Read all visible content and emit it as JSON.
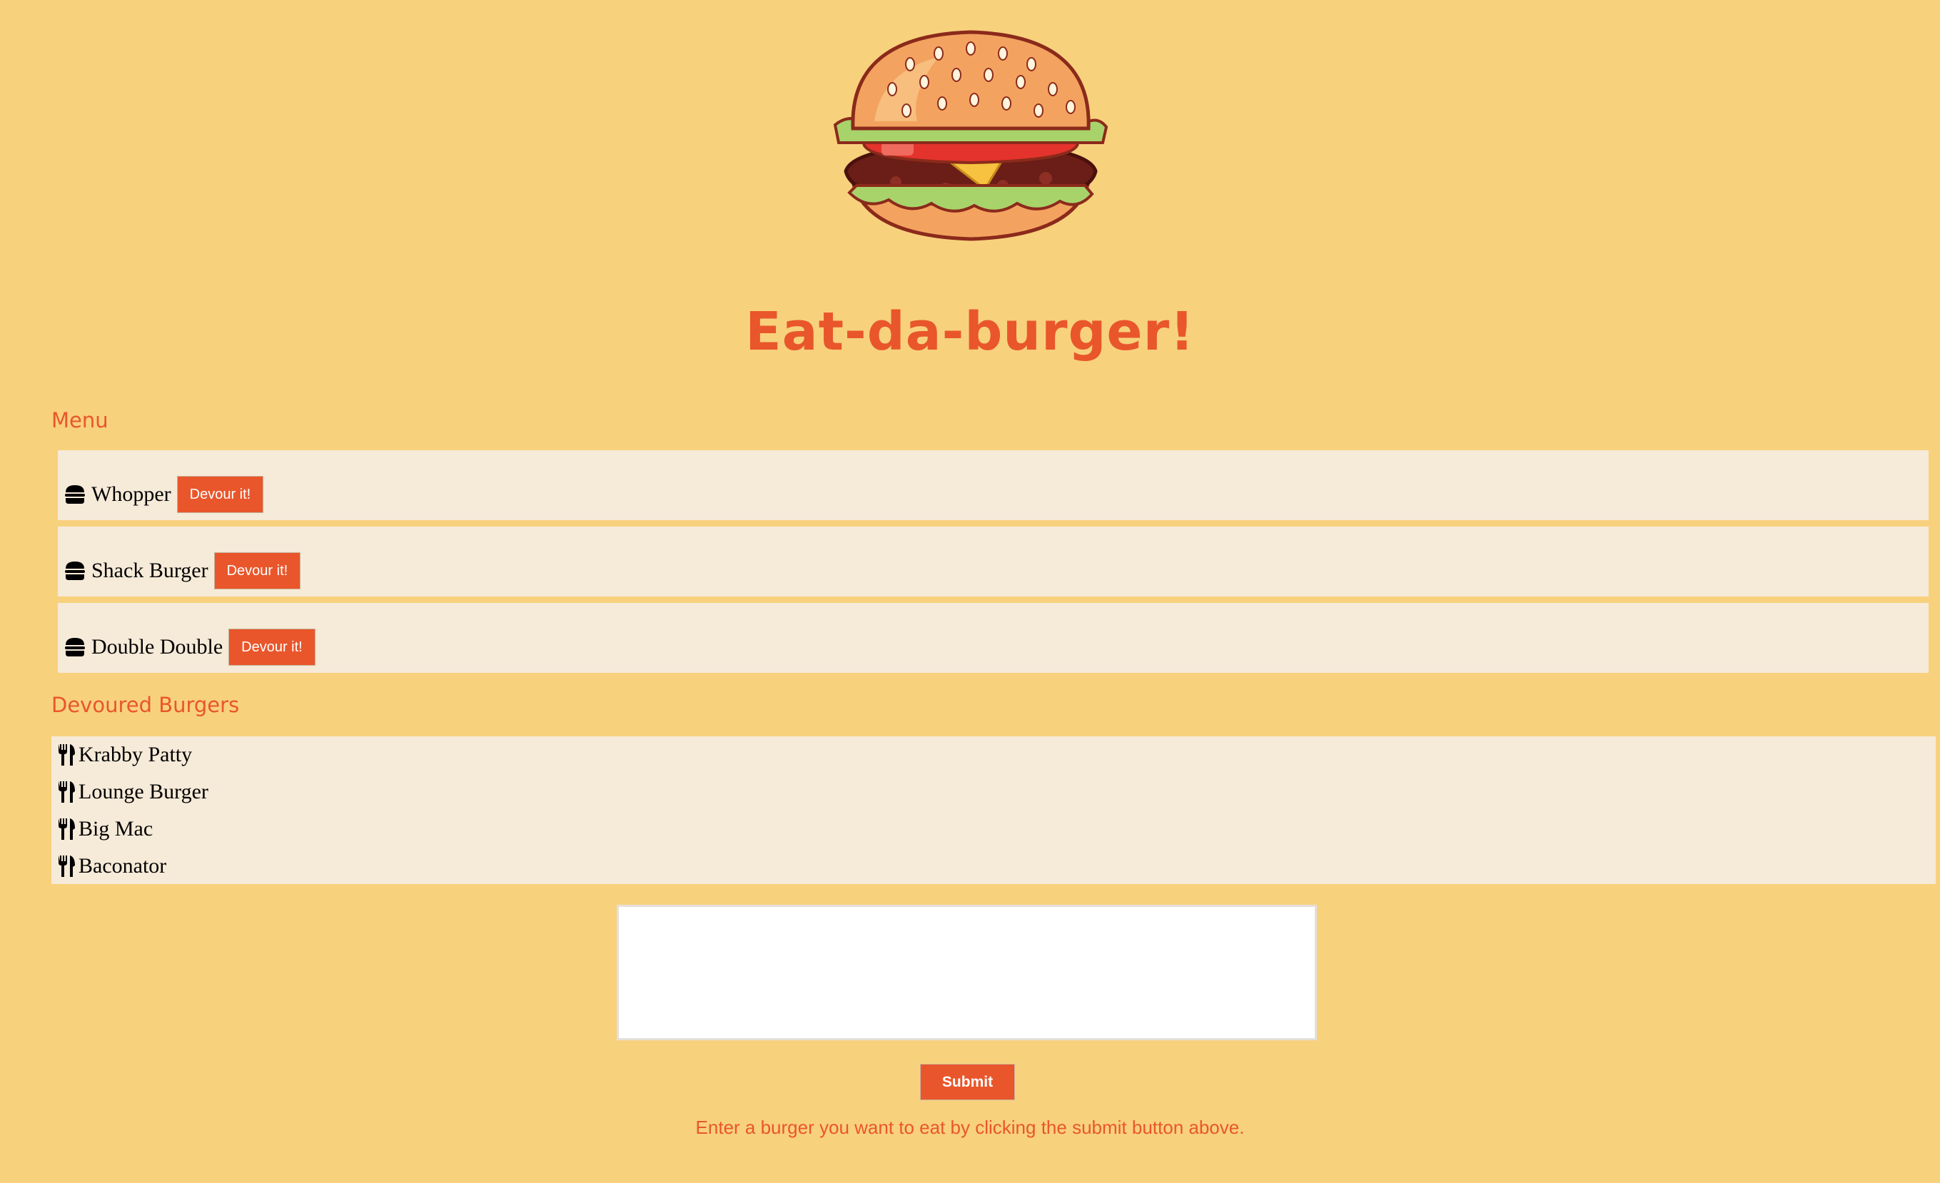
{
  "header": {
    "logo_icon": "burger-logo",
    "title": "Eat-da-burger!"
  },
  "menu": {
    "heading": "Menu",
    "item_icon": "hamburger-icon",
    "items": [
      {
        "name": "Whopper",
        "button_label": "Devour it!"
      },
      {
        "name": "Shack Burger",
        "button_label": "Devour it!"
      },
      {
        "name": "Double Double",
        "button_label": "Devour it!"
      }
    ]
  },
  "devoured": {
    "heading": "Devoured Burgers",
    "item_icon": "utensils-icon",
    "items": [
      {
        "name": "Krabby Patty"
      },
      {
        "name": "Lounge Burger"
      },
      {
        "name": "Big Mac"
      },
      {
        "name": "Baconator"
      }
    ]
  },
  "form": {
    "input_value": "",
    "submit_label": "Submit",
    "help_text": "Enter a burger you want to eat by clicking the submit button above."
  },
  "colors": {
    "background": "#f8d17d",
    "accent": "#e9562b",
    "panel": "#f6ead8"
  }
}
